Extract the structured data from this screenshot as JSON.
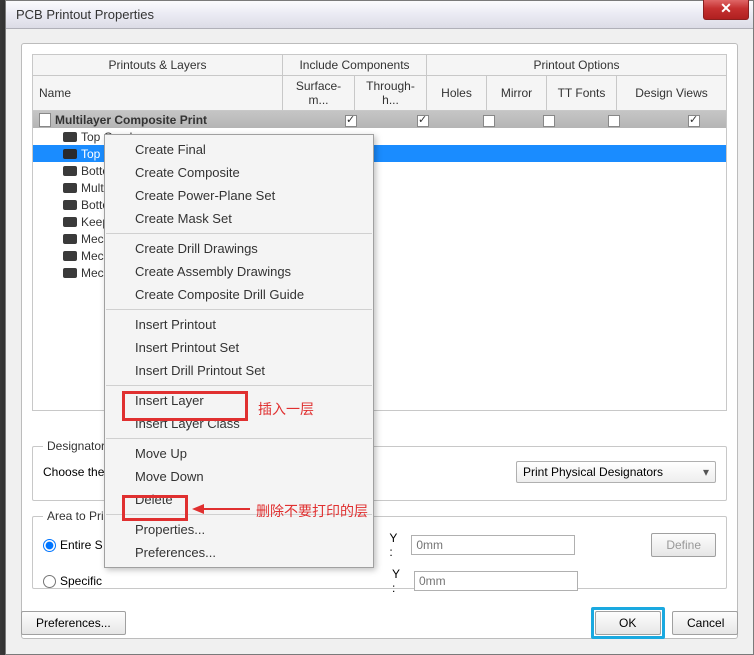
{
  "window": {
    "title": "PCB Printout Properties"
  },
  "headers": {
    "group1": "Printouts & Layers",
    "group2": "Include Components",
    "group3": "Printout Options",
    "name": "Name",
    "surface": "Surface-m...",
    "through": "Through-h...",
    "holes": "Holes",
    "mirror": "Mirror",
    "ttfonts": "TT Fonts",
    "design": "Design Views"
  },
  "printout": {
    "title": "Multilayer Composite Print",
    "layers": [
      "Top Overlay",
      "Top Layer",
      "Bottom",
      "Multi-",
      "Bottom",
      "Keep-",
      "Mecha",
      "Mecha",
      "Mecha"
    ]
  },
  "menu": {
    "g1": [
      "Create Final",
      "Create Composite",
      "Create Power-Plane Set",
      "Create Mask Set"
    ],
    "g2": [
      "Create Drill Drawings",
      "Create Assembly Drawings",
      "Create Composite Drill Guide"
    ],
    "g3": [
      "Insert Printout",
      "Insert Printout Set",
      "Insert Drill Printout Set"
    ],
    "g4": [
      "Insert Layer",
      "Insert Layer Class"
    ],
    "g5": [
      "Move Up",
      "Move Down",
      "Delete"
    ],
    "g6": [
      "Properties...",
      "Preferences..."
    ]
  },
  "annotations": {
    "insert": "插入一层",
    "delete": "删除不要打印的层"
  },
  "designator": {
    "group": "Designator",
    "choose": "Choose the",
    "combo": "Print Physical Designators"
  },
  "area": {
    "group": "Area to Pri",
    "entire": "Entire S",
    "specific": "Specific",
    "y": "Y :",
    "placeholder": "0mm",
    "define": "Define"
  },
  "buttons": {
    "preferences": "Preferences...",
    "ok": "OK",
    "cancel": "Cancel"
  }
}
